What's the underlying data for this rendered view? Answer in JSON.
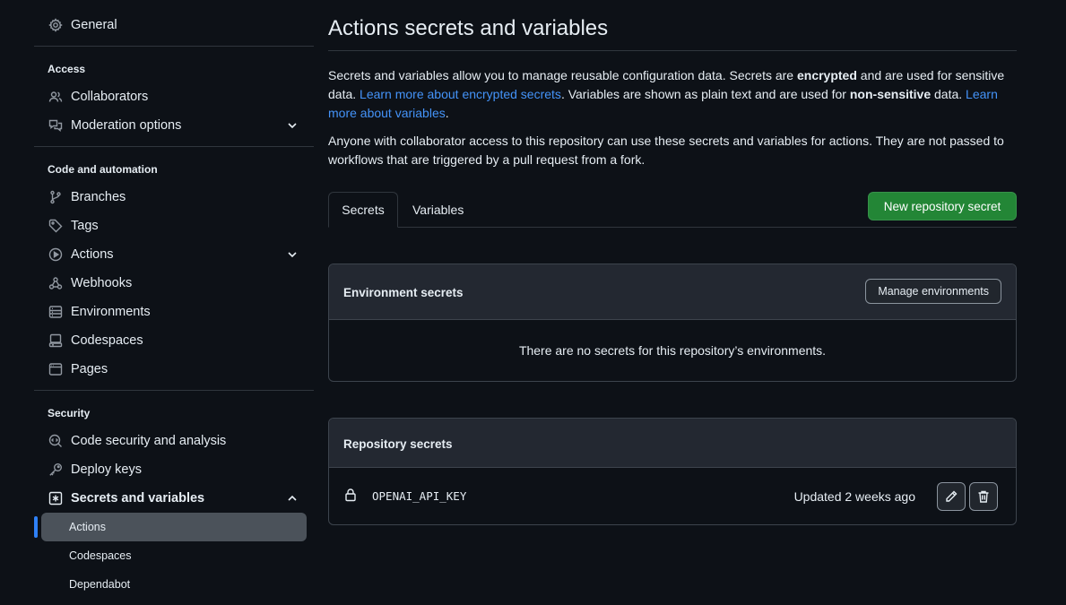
{
  "sidebar": {
    "general": "General",
    "sections": {
      "access": "Access",
      "code_automation": "Code and automation",
      "security": "Security"
    },
    "items": {
      "collaborators": "Collaborators",
      "moderation": "Moderation options",
      "branches": "Branches",
      "tags": "Tags",
      "actions": "Actions",
      "webhooks": "Webhooks",
      "environments": "Environments",
      "codespaces": "Codespaces",
      "pages": "Pages",
      "code_security": "Code security and analysis",
      "deploy_keys": "Deploy keys",
      "secrets_variables": "Secrets and variables"
    },
    "sub_items": {
      "actions": "Actions",
      "codespaces": "Codespaces",
      "dependabot": "Dependabot"
    }
  },
  "main": {
    "title": "Actions secrets and variables",
    "intro": {
      "p1_a": "Secrets and variables allow you to manage reusable configuration data. Secrets are ",
      "p1_b": "encrypted",
      "p1_c": " and are used for sensitive data. ",
      "p1_link1": "Learn more about encrypted secrets",
      "p1_d": ". Variables are shown as plain text and are used for ",
      "p1_e": "non-sensitive",
      "p1_f": " data. ",
      "p1_link2": "Learn more about variables",
      "p1_g": ".",
      "p2": "Anyone with collaborator access to this repository can use these secrets and variables for actions. They are not passed to workflows that are triggered by a pull request from a fork."
    },
    "tabs": {
      "secrets": "Secrets",
      "variables": "Variables"
    },
    "new_secret_button": "New repository secret",
    "env_secrets": {
      "title": "Environment secrets",
      "manage_button": "Manage environments",
      "empty": "There are no secrets for this repository’s environments."
    },
    "repo_secrets": {
      "title": "Repository secrets",
      "rows": [
        {
          "name": "OPENAI_API_KEY",
          "updated": "Updated 2 weeks ago"
        }
      ]
    }
  },
  "colors": {
    "background": "#0d1117",
    "accent_green": "#238636",
    "link": "#4493f8",
    "active_indicator": "#2f81f7"
  }
}
